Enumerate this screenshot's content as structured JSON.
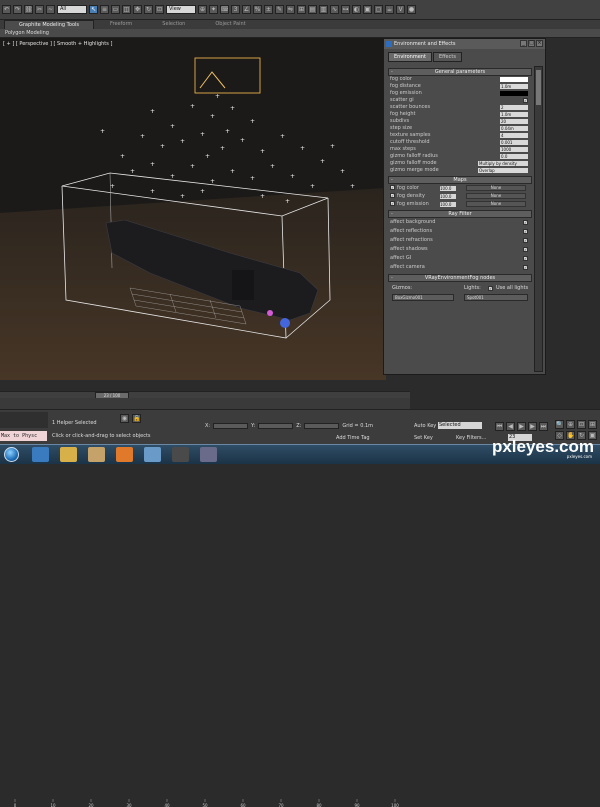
{
  "toolbar": {
    "selection_filter": "All",
    "reference_coord": "View"
  },
  "ribbon": {
    "tabs": [
      "Graphite Modeling Tools",
      "Freeform",
      "Selection",
      "Object Paint"
    ],
    "sub_panel": "Polygon Modeling"
  },
  "viewport": {
    "label": "[ + ] [ Perspective ] [ Smooth + Highlights ]"
  },
  "env_dialog": {
    "title": "Environment and Effects",
    "tabs": [
      "Environment",
      "Effects"
    ],
    "general": {
      "header": "General parameters",
      "params": [
        {
          "label": "fog color",
          "value": "",
          "kind": "swatch-white"
        },
        {
          "label": "fog distance",
          "value": "1.0m"
        },
        {
          "label": "fog emission",
          "value": "",
          "kind": "swatch-black"
        },
        {
          "label": "scatter gi",
          "value": "",
          "kind": "check"
        },
        {
          "label": "scatter bounces",
          "value": "2"
        },
        {
          "label": "fog height",
          "value": "1.0m"
        },
        {
          "label": "subdivs",
          "value": "20"
        },
        {
          "label": "step size",
          "value": "0.04m"
        },
        {
          "label": "texture samples",
          "value": "4"
        },
        {
          "label": "cutoff threshold",
          "value": "0.001"
        },
        {
          "label": "max steps",
          "value": "1000"
        },
        {
          "label": "gizmo falloff radius",
          "value": "0.0"
        },
        {
          "label": "gizmo falloff mode",
          "value": "Multiply by density",
          "kind": "wide"
        },
        {
          "label": "gizmo merge mode",
          "value": "Overlap",
          "kind": "wide"
        }
      ]
    },
    "maps": {
      "header": "Maps",
      "rows": [
        {
          "label": "fog color",
          "amount": "100.0",
          "map": "None"
        },
        {
          "label": "fog density",
          "amount": "100.0",
          "map": "None"
        },
        {
          "label": "fog emission",
          "amount": "100.0",
          "map": "None"
        }
      ]
    },
    "ray_filter": {
      "header": "Ray Filter",
      "rows": [
        "affect background",
        "affect reflections",
        "affect refractions",
        "affect shadows",
        "affect GI",
        "affect camera"
      ]
    },
    "nodes": {
      "header": "VRayEnvironmentFog nodes",
      "gizmos_label": "Gizmos:",
      "lights_label": "Lights:",
      "use_all_lights": "Use all lights",
      "gizmo_item": "BoxGizmo001",
      "light_item": "Spot001"
    }
  },
  "timeline": {
    "frame_indicator": "23 / 100",
    "ticks": [
      "0",
      "10",
      "20",
      "30",
      "40",
      "50",
      "60",
      "70",
      "80",
      "90",
      "100"
    ]
  },
  "status": {
    "maxscript": "Max to Physc",
    "selection": "1 Helper Selected",
    "prompt": "Click or click-and-drag to select objects",
    "coord_x": "X:",
    "coord_y": "Y:",
    "coord_z": "Z:",
    "grid": "Grid = 0.1m",
    "add_time_tag": "Add Time Tag",
    "auto_key": "Auto Key",
    "set_key": "Set Key",
    "key_mode": "Selected",
    "key_filters": "Key Filters...",
    "frame_spinner": "23"
  },
  "watermark": {
    "brand": "pxleyes.com",
    "sub": "pxleyes.com"
  }
}
